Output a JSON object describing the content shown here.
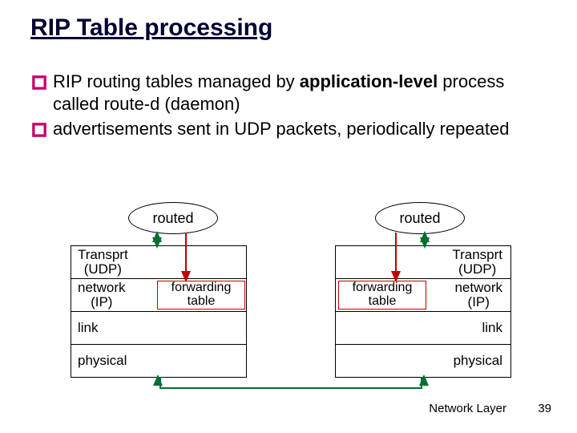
{
  "title": "RIP Table processing",
  "bullets": [
    {
      "pre": "RIP routing tables managed by ",
      "bold": "application-level",
      "post": " process called route-d (daemon)"
    },
    {
      "pre": "advertisements sent in UDP packets, periodically repeated",
      "bold": "",
      "post": ""
    }
  ],
  "diagram": {
    "routed_left": "routed",
    "routed_right": "routed",
    "left_stack": {
      "transport": "Transprt\n(UDP)",
      "network": "network\n(IP)",
      "link": "link",
      "physical": "physical"
    },
    "right_stack": {
      "transport": "Transprt\n(UDP)",
      "network": "network\n(IP)",
      "link": "link",
      "physical": "physical"
    },
    "fwd_left": "forwarding\ntable",
    "fwd_right": "forwarding\ntable"
  },
  "footer": {
    "label": "Network Layer",
    "page": "39"
  }
}
